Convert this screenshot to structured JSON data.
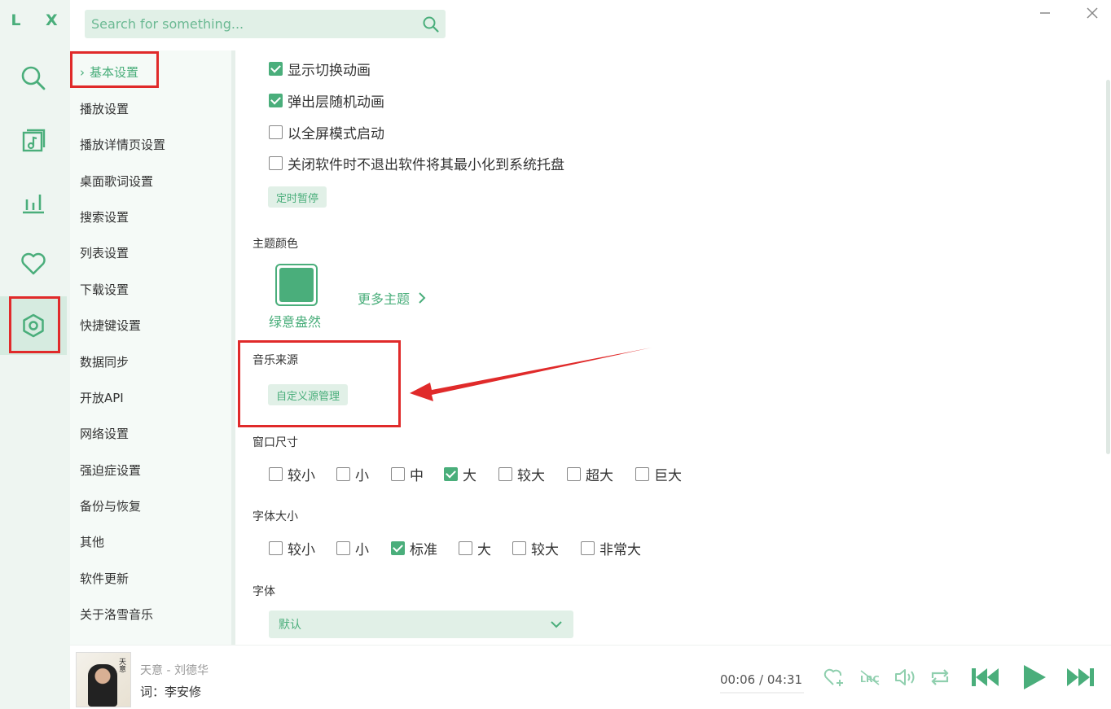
{
  "app": {
    "logo": "L X"
  },
  "search": {
    "placeholder": "Search for something..."
  },
  "settings_nav": {
    "items": [
      "基本设置",
      "播放设置",
      "播放详情页设置",
      "桌面歌词设置",
      "搜索设置",
      "列表设置",
      "下载设置",
      "快捷键设置",
      "数据同步",
      "开放API",
      "网络设置",
      "强迫症设置",
      "备份与恢复",
      "其他",
      "软件更新",
      "关于洛雪音乐"
    ],
    "active_index": 0
  },
  "general": {
    "checkboxes": [
      {
        "label": "显示切换动画",
        "checked": true
      },
      {
        "label": "弹出层随机动画",
        "checked": true
      },
      {
        "label": "以全屏模式启动",
        "checked": false
      },
      {
        "label": "关闭软件时不退出软件将其最小化到系统托盘",
        "checked": false
      }
    ],
    "timer_button": "定时暂停"
  },
  "theme": {
    "title": "主题颜色",
    "current": "绿意盎然",
    "more": "更多主题",
    "color": "#4aae7b"
  },
  "source": {
    "title": "音乐来源",
    "button": "自定义源管理"
  },
  "window_size": {
    "title": "窗口尺寸",
    "options": [
      {
        "label": "较小",
        "checked": false
      },
      {
        "label": "小",
        "checked": false
      },
      {
        "label": "中",
        "checked": false
      },
      {
        "label": "大",
        "checked": true
      },
      {
        "label": "较大",
        "checked": false
      },
      {
        "label": "超大",
        "checked": false
      },
      {
        "label": "巨大",
        "checked": false
      }
    ]
  },
  "font_size": {
    "title": "字体大小",
    "options": [
      {
        "label": "较小",
        "checked": false
      },
      {
        "label": "小",
        "checked": false
      },
      {
        "label": "标准",
        "checked": true
      },
      {
        "label": "大",
        "checked": false
      },
      {
        "label": "较大",
        "checked": false
      },
      {
        "label": "非常大",
        "checked": false
      }
    ]
  },
  "font": {
    "title": "字体",
    "selected": "默认"
  },
  "player": {
    "title": "天意 - 刘德华",
    "lyric": "词：李安修",
    "cover_text": "天意",
    "current_time": "00:06",
    "total_time": "04:31",
    "time_sep": "/",
    "lrc_label": "LRC"
  },
  "colors": {
    "accent": "#4aae7b",
    "accent_light": "#e1f0e7",
    "annotation": "#e02a2a"
  }
}
